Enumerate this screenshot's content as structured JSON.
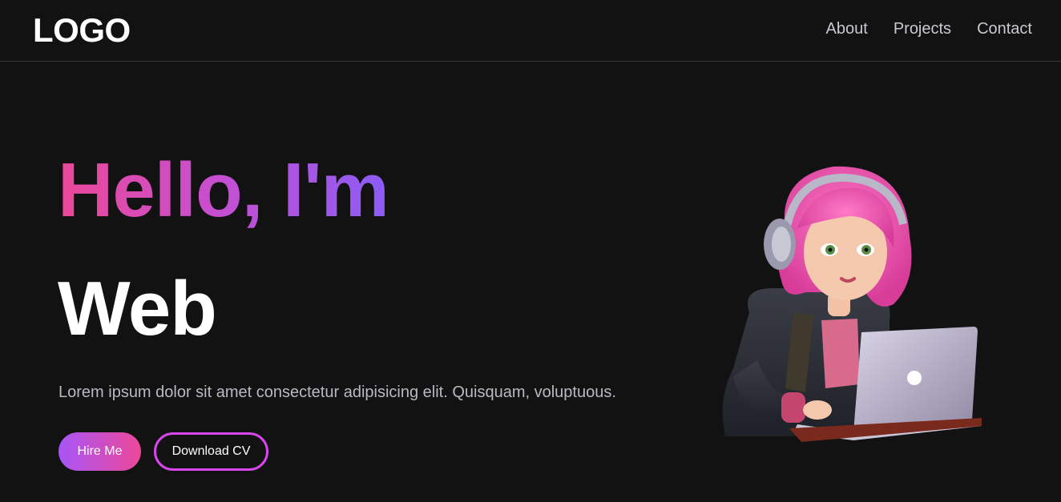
{
  "header": {
    "logo": "LOGO",
    "nav": [
      "About",
      "Projects",
      "Contact"
    ]
  },
  "hero": {
    "greeting": "Hello, I'm",
    "role": "Web",
    "description": "Lorem ipsum dolor sit amet consectetur adipisicing elit. Quisquam, voluptuous.",
    "primary_button": "Hire Me",
    "secondary_button": "Download CV"
  },
  "colors": {
    "background": "#121212",
    "accent_pink": "#ec4899",
    "accent_purple": "#8b5cf6",
    "button_border": "#d946ef"
  },
  "icons": {
    "illustration": "girl-with-laptop-avatar"
  }
}
